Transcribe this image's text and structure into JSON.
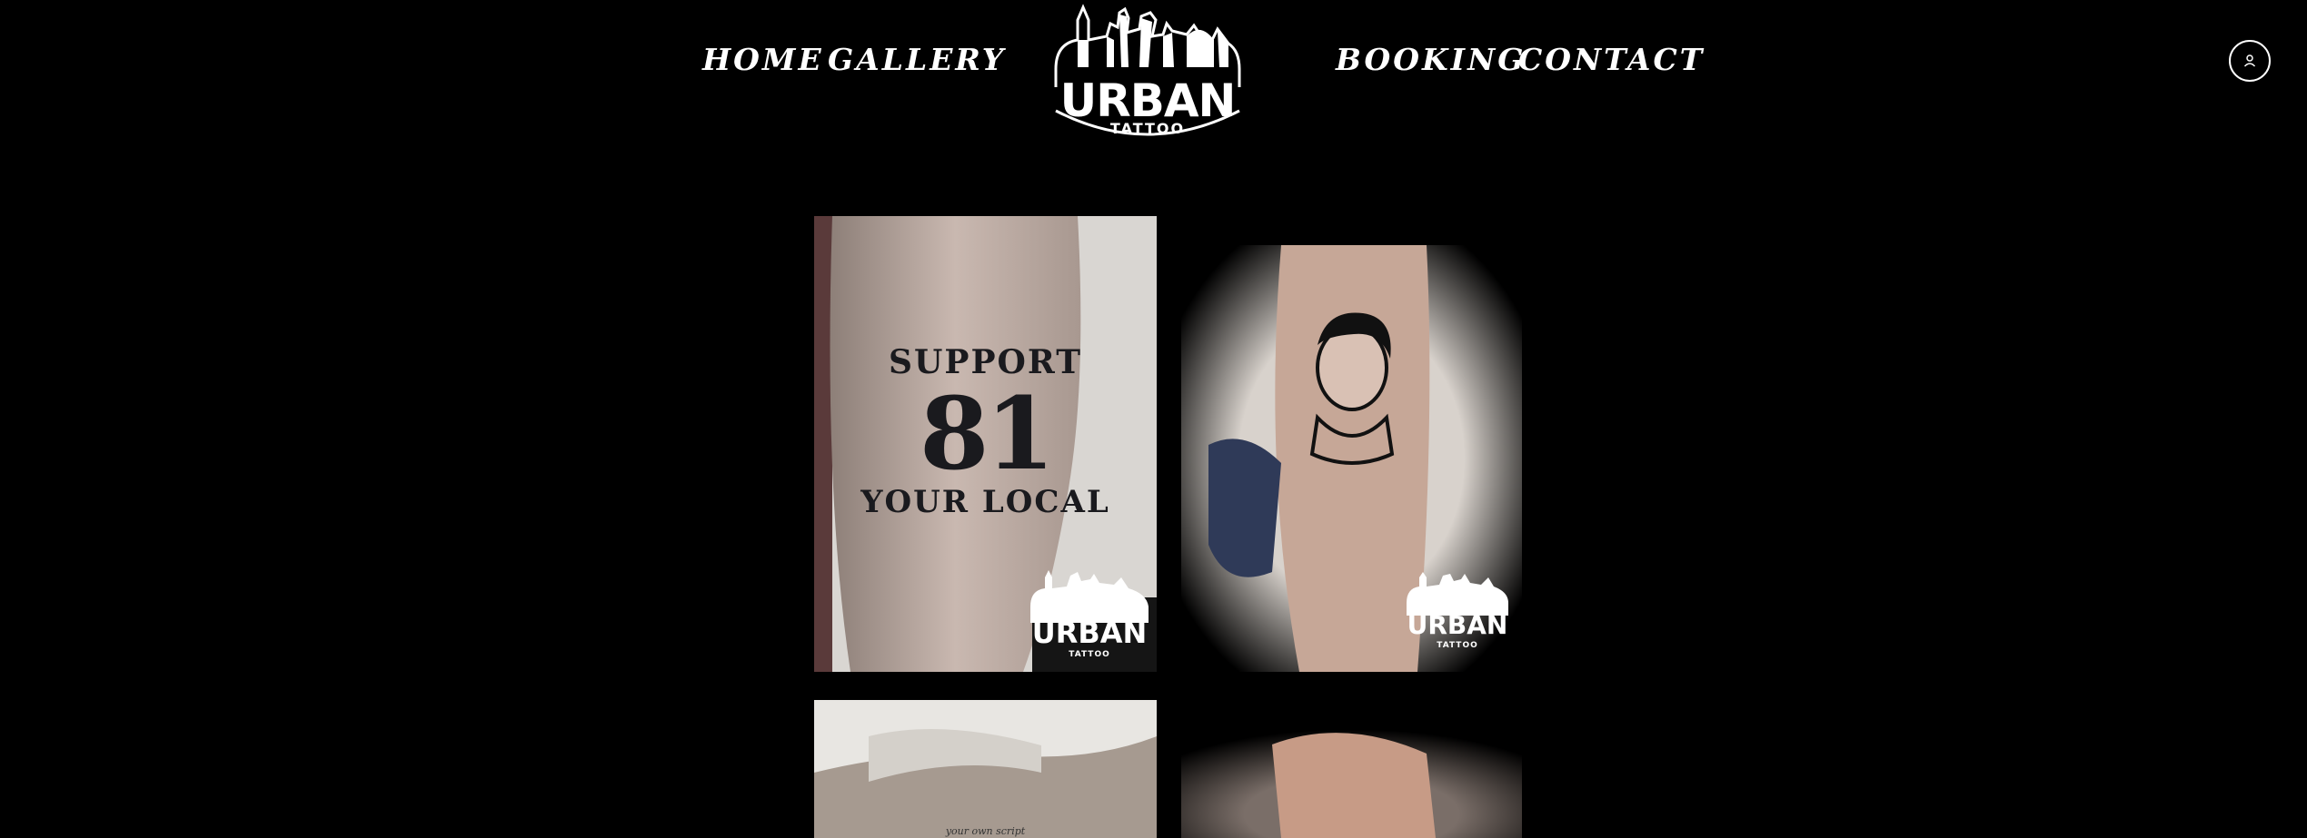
{
  "nav": {
    "home": "HOME",
    "gallery": "GALLERY",
    "booking": "BOOKING",
    "contact": "CONTACT"
  },
  "logo": {
    "word": "URBAN",
    "sub": "TATTOO"
  },
  "account": {
    "icon": "user-icon"
  },
  "gallery": [
    {
      "tattoo_top": "SUPPORT",
      "tattoo_number": "81",
      "tattoo_bottom": "YOUR LOCAL",
      "watermark_word": "URBAN",
      "watermark_sub": "TATTOO"
    },
    {
      "watermark_word": "URBAN",
      "watermark_sub": "TATTOO"
    },
    {
      "script": "your own script"
    },
    {}
  ],
  "colors": {
    "background": "#000000",
    "text": "#ffffff"
  }
}
